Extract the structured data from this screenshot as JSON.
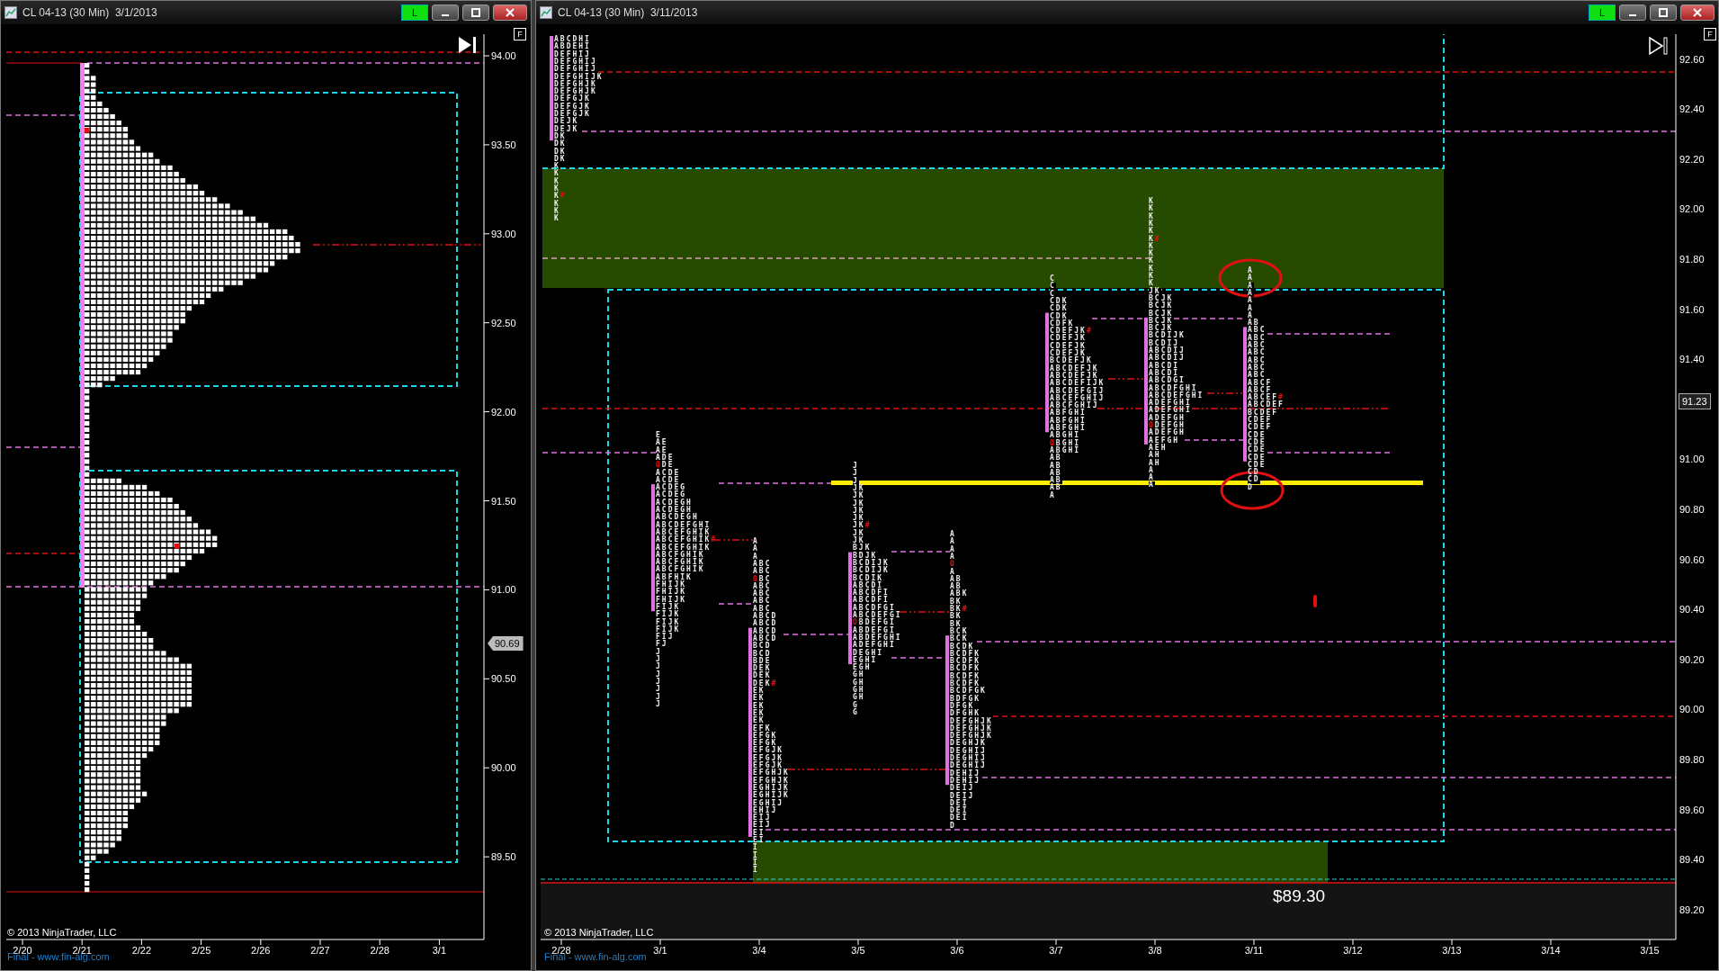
{
  "left_window": {
    "title": "CL 04-13 (30 Min)  3/1/2013",
    "mode_button": "L",
    "f_button": "F",
    "price_labels": [
      "94.00",
      "93.50",
      "93.00",
      "92.50",
      "92.00",
      "91.50",
      "91.00",
      "90.50",
      "90.00",
      "89.50"
    ],
    "current_price": "90.69",
    "date_labels": [
      "2/20",
      "2/21",
      "2/22",
      "2/25",
      "2/26",
      "2/27",
      "2/28",
      "3/1"
    ],
    "copyright": "© 2013 NinjaTrader, LLC",
    "footer_link": "Final - www.fin-alg.com"
  },
  "right_window": {
    "title": "CL 04-13 (30 Min)  3/11/2013",
    "mode_button": "L",
    "f_button": "F",
    "price_labels": [
      "92.60",
      "92.40",
      "92.20",
      "92.00",
      "91.80",
      "91.60",
      "91.40",
      "91.00",
      "90.80",
      "90.60",
      "90.40",
      "90.20",
      "90.00",
      "89.80",
      "89.60",
      "89.40",
      "89.20"
    ],
    "current_price": "91.23",
    "date_labels": [
      "2/28",
      "3/1",
      "3/4",
      "3/5",
      "3/6",
      "3/7",
      "3/8",
      "3/11",
      "3/12",
      "3/13",
      "3/14",
      "3/15"
    ],
    "price_note": "$89.30",
    "tpo_columns": [
      {
        "rows": [
          "ABCDHI",
          "ABDEHI",
          "DEFHIJ",
          "DEFGHIJ",
          "DEFGHIJ",
          "DEFGHIJK",
          "DEFGHJK",
          "DEFGHJK",
          "DEFGJK",
          "DEFGJK",
          "DEFGJK",
          "DEJK",
          "DEJK",
          "DK",
          "DK",
          "DK",
          "DK",
          "K",
          "K",
          "K",
          "K",
          {
            "text": "K#",
            "kind": "close"
          },
          "K",
          "K",
          "K"
        ]
      },
      {
        "rows": [
          "E",
          "AE",
          "AE",
          "ADE",
          {
            "text": "ODE",
            "kind": "open"
          },
          "ACDE",
          "ACDE",
          "ACDEG",
          "ACDEG",
          "ACDEGH",
          "ACDEGH",
          "ABCDEGH",
          "ABCDEFGHI",
          "ABCEFGHIK",
          {
            "text": "ABCEFGHIK#",
            "kind": "close"
          },
          "ABCEFGHIK",
          "ABCFGHIK",
          "ABCFGHIK",
          "ABCFGHIK",
          "ABFHIK",
          "FHIJK",
          "FHIJK",
          "FHIJK",
          "FIJK",
          "FIJK",
          "FIJK",
          "FIJK",
          "FIJ",
          "FJ",
          "J",
          "J",
          "J",
          "J",
          "J",
          "J",
          "J",
          "J"
        ]
      },
      {
        "rows": [
          "A",
          "A",
          "A",
          "ABC",
          "ABC",
          {
            "text": "OBC",
            "kind": "open"
          },
          "ABC",
          "ABC",
          "ABC",
          "ABC",
          "ABCD",
          "ABCD",
          "ABCD",
          "ABCD",
          "BCD",
          "BCD",
          "BDE",
          "DEK",
          "DEK",
          {
            "text": "DEK#",
            "kind": "close"
          },
          "EK",
          "EK",
          "EK",
          "EK",
          "EK",
          "EFK",
          "EFGK",
          "EFGK",
          "EFGJK",
          "EFGJK",
          "EFGJK",
          "EFGHJK",
          "EFGHJK",
          "EGHIJK",
          "EGHIJK",
          "EGHIJ",
          "EHIJ",
          "EIJ",
          "EIJ",
          "EI",
          "EI",
          "I",
          "I",
          "I",
          "I"
        ]
      },
      {
        "rows": [
          "J",
          "J",
          "J",
          "JK",
          "JK",
          "JK",
          "JK",
          "JK",
          {
            "text": "JK#",
            "kind": "close"
          },
          "JK",
          "JK",
          "BJK",
          "BDJK",
          "BCDIJK",
          "BCDIJK",
          "BCDIK",
          "ABCDI",
          "ABCDFI",
          "ABCDFI",
          "ABCDFGI",
          "ABCDEFGI",
          {
            "text": "OBDEFGI",
            "kind": "open"
          },
          "ABDEFGI",
          "ABDEFGHI",
          "ADEFGHI",
          "DEGHI",
          "EGHI",
          "EGH",
          "GH",
          "GH",
          "GH",
          "GH",
          "G",
          "G"
        ]
      },
      {
        "rows": [
          "A",
          "A",
          "A",
          "A",
          {
            "text": "O",
            "kind": "open"
          },
          "A",
          "AB",
          "AB",
          "ABK",
          "BK",
          {
            "text": "BK#",
            "kind": "close"
          },
          "BK",
          "BK",
          "BCK",
          "BCK",
          "BCDK",
          "BCDFK",
          "BCDFK",
          "BCDFK",
          "BCDFK",
          "BCDFK",
          "BCDFGK",
          "BDFGK",
          "DFGK",
          "DFGHK",
          "DEFGHJK",
          "DEFGHJK",
          "DEFGHJK",
          "DEGHJK",
          "DEGHIJ",
          "DEGHIJ",
          "DEGHIJ",
          "DEHIJ",
          "DEHIJ",
          "DEIJ",
          "DEIJ",
          "DEI",
          "DEI",
          "DEI",
          "D"
        ]
      },
      {
        "rows": [
          "C",
          "C",
          "C",
          "CDK",
          "CDK",
          "CDK",
          "CDFK",
          {
            "text": "CDEFJK#",
            "kind": "close"
          },
          "CDEFJK",
          "CDEFJK",
          "CDEFJK",
          "BCDEFJK",
          "ABCDEFJK",
          "ABCDEFJK",
          "ABCDEFIJK",
          "ABCDEFGIJ",
          "ABCEFGHIJ",
          "ABCFGHIJ",
          "ABFGHI",
          "ABFGHI",
          "ABFGHI",
          "ABGHI",
          {
            "text": "OBGHI",
            "kind": "open"
          },
          "ABGHI",
          "AB",
          "AB",
          "AB",
          "AB",
          "AB",
          "A"
        ]
      },
      {
        "rows": [
          "K",
          "K",
          "K",
          "K",
          "K",
          {
            "text": "K#",
            "kind": "close"
          },
          "K",
          "K",
          "K",
          "K",
          "K",
          "K",
          "JK",
          "BCJK",
          "BCJK",
          "BCJK",
          "BCJK",
          "BCJK",
          "BCDIJK",
          "BCDIJ",
          "ABCDIJ",
          "ABCDIJ",
          "ABCDI",
          "ABCDI",
          "ABCDGI",
          "ABCDFGHI",
          "ABCDEFGHI",
          "ADEFGHI",
          "ADEFGHI",
          "ADEFGH",
          {
            "text": "ODEFGH",
            "kind": "open"
          },
          "ADEFGH",
          "AEFGH",
          "AEH",
          "AH",
          "AH",
          "A",
          "A",
          "A"
        ]
      },
      {
        "rows": [
          "A",
          "A",
          "A",
          "A",
          "A",
          "A",
          "A",
          "AB",
          "ABC",
          "ABC",
          "ABC",
          "ABC",
          "ABC",
          "ABC",
          "ABC",
          "ABCF",
          "ABCF",
          {
            "text": "ABCEF#",
            "kind": "close"
          },
          "ABCDEF",
          "BCDEF",
          "CDEF",
          "CDEF",
          "CDE",
          "CDE",
          "CDE",
          "CDE",
          "CDE",
          "CD",
          "CD",
          "D"
        ]
      }
    ],
    "copyright": "© 2013 NinjaTrader, LLC",
    "footer_link": "Final - www.fin-alg.com"
  }
}
